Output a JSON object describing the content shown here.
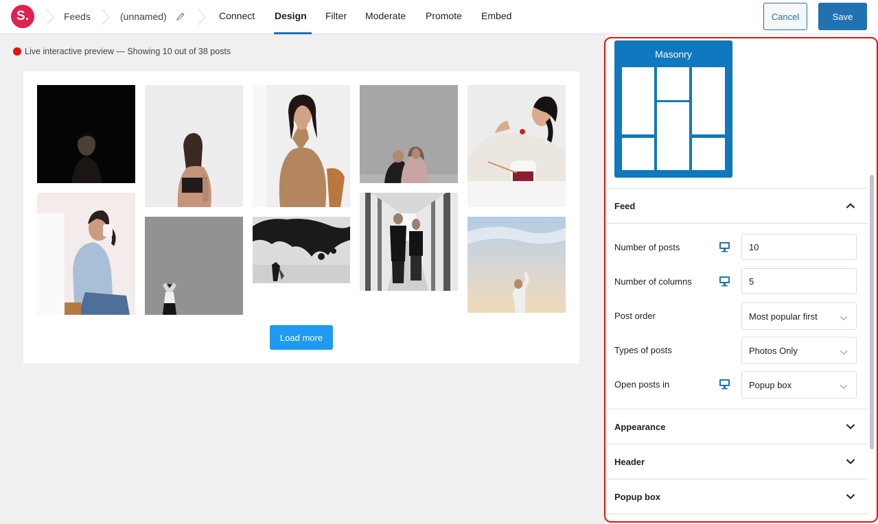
{
  "header": {
    "logo_text": "S.",
    "breadcrumb": [
      "Feeds",
      "(unnamed)"
    ],
    "tabs": [
      "Connect",
      "Design",
      "Filter",
      "Moderate",
      "Promote",
      "Embed"
    ],
    "active_tab": "Design",
    "cancel_label": "Cancel",
    "save_label": "Save"
  },
  "preview": {
    "status_text": "Live interactive preview — Showing 10 out of 38 posts",
    "load_more_label": "Load more"
  },
  "sidebar": {
    "layout_label": "Masonry",
    "sections": {
      "feed": "Feed",
      "appearance": "Appearance",
      "header": "Header",
      "popup": "Popup box"
    },
    "feed_rows": [
      {
        "label": "Number of posts",
        "value": "10",
        "type": "input",
        "device_icon": "desktop-icon"
      },
      {
        "label": "Number of columns",
        "value": "5",
        "type": "input",
        "device_icon": "desktop-icon"
      },
      {
        "label": "Post order",
        "value": "Most popular first",
        "type": "select"
      },
      {
        "label": "Types of posts",
        "value": "Photos Only",
        "type": "select"
      },
      {
        "label": "Open posts in",
        "value": "Popup box",
        "type": "select",
        "device_icon": "desktop-icon"
      }
    ]
  },
  "colors": {
    "accent": "#2271b1",
    "brand": "#e0214e",
    "live_indicator": "#e2140b",
    "load_more": "#1e9bf0"
  }
}
